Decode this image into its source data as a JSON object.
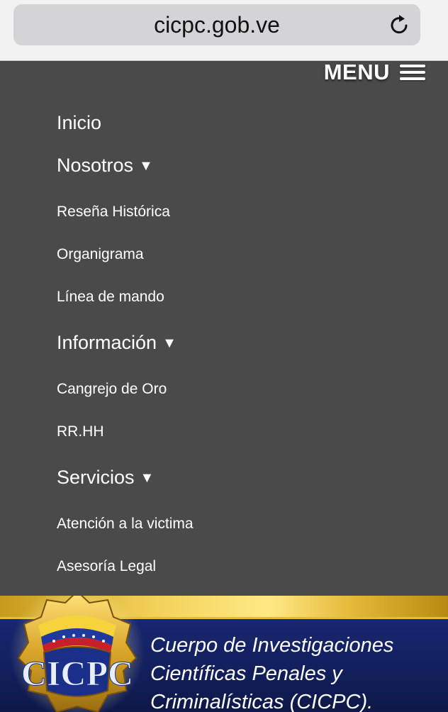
{
  "browser": {
    "url": "cicpc.gob.ve",
    "reload_icon": "reload-icon"
  },
  "menu": {
    "toggle_label": "MENU",
    "toggle_icon": "hamburger-icon",
    "items": {
      "inicio": "Inicio",
      "nosotros": "Nosotros",
      "resena": "Reseña Histórica",
      "organigrama": "Organigrama",
      "linea": "Línea de mando",
      "informacion": "Información",
      "cangrejo": "Cangrejo de Oro",
      "rrhh": "RR.HH",
      "servicios": "Servicios",
      "atencion": "Atención a la victima",
      "asesoria": "Asesoría Legal"
    },
    "dropdown_arrow": "▼"
  },
  "banner": {
    "line1": "Cuerpo de Investigaciones",
    "line2": "Científicas Penales y",
    "line3": "Criminalísticas (CICPC).",
    "badge_text": "CICPC",
    "colors": {
      "navy": "#13205f",
      "gold": "#f3d25a"
    }
  }
}
